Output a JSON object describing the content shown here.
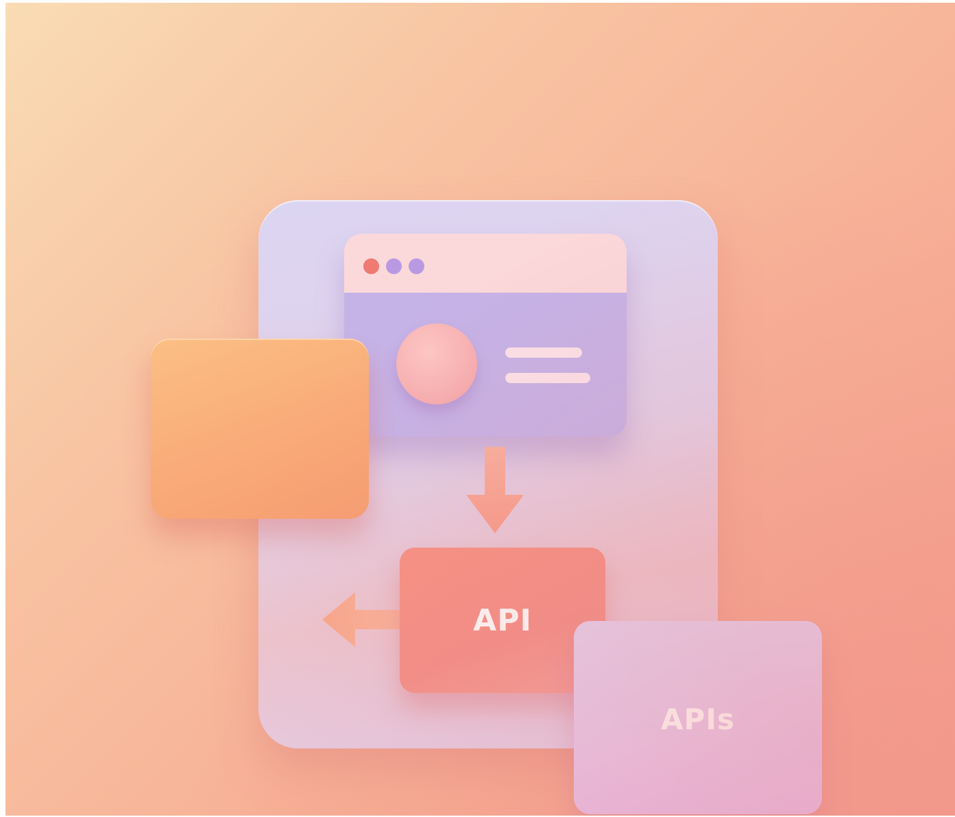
{
  "illustration": {
    "browser_window": {
      "dots": [
        "red-dot",
        "purple-dot",
        "purple-dot"
      ]
    },
    "api_box": {
      "label": "API"
    },
    "apis_card": {
      "label": "APIs"
    },
    "colors": {
      "background_start": "#f9dcb4",
      "background_end": "#f5a08e",
      "phone": "#dcd5f2",
      "browser_body": "#c5b3e8",
      "browser_bar": "#fbd9db",
      "orange_card": "#fbbf84",
      "api_box": "#f69284",
      "apis_card": "#e3d3f1",
      "arrow": "#f8a893"
    },
    "icons": [
      "down-arrow-icon",
      "left-arrow-icon"
    ]
  }
}
